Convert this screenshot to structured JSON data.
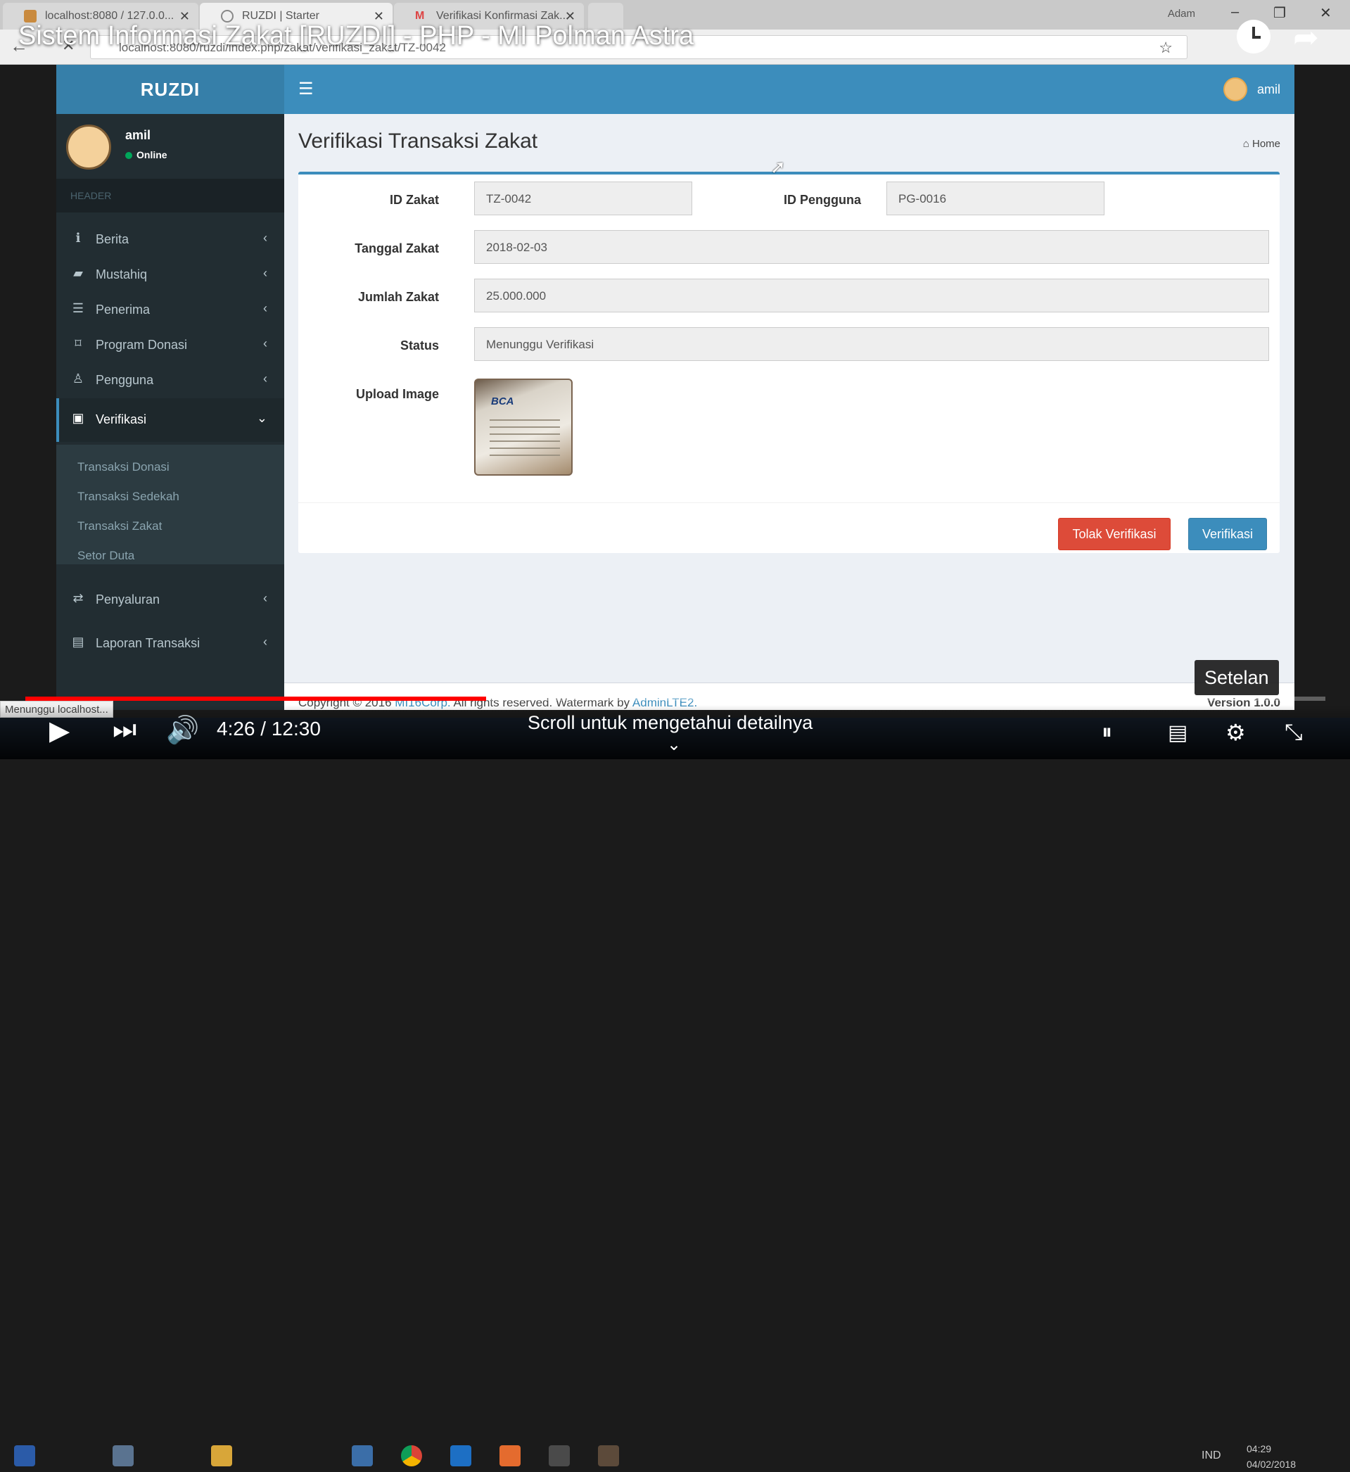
{
  "browser": {
    "tabs": [
      {
        "label": "localhost:8080 / 127.0.0...",
        "active": false
      },
      {
        "label": "RUZDI | Starter",
        "active": true
      },
      {
        "label": "Verifikasi Konfirmasi Zak...",
        "active": false
      }
    ],
    "window_user": "Adam",
    "url": "localhost:8080/ruzdi/index.php/zakat/verifikasi_zakat/TZ-0042",
    "status": "Menunggu localhost..."
  },
  "app": {
    "logo": "RUZDI",
    "top_user": "amil",
    "sidebar": {
      "user_name": "amil",
      "user_status": "Online",
      "header": "HEADER",
      "items": [
        {
          "label": "Berita",
          "icon": "info-icon"
        },
        {
          "label": "Mustahiq",
          "icon": "book-icon"
        },
        {
          "label": "Penerima",
          "icon": "list-icon"
        },
        {
          "label": "Program Donasi",
          "icon": "bookmark-icon"
        },
        {
          "label": "Pengguna",
          "icon": "user-icon"
        },
        {
          "label": "Verifikasi",
          "icon": "calendar-check-icon",
          "active": true
        },
        {
          "label": "Penyaluran",
          "icon": "exchange-icon"
        },
        {
          "label": "Laporan Transaksi",
          "icon": "report-icon"
        }
      ],
      "submenu": [
        "Transaksi Donasi",
        "Transaksi Sedekah",
        "Transaksi Zakat",
        "Setor Duta"
      ]
    },
    "page": {
      "title": "Verifikasi Transaksi Zakat",
      "breadcrumb": "Home",
      "form": {
        "id_zakat_label": "ID Zakat",
        "id_zakat": "TZ-0042",
        "id_pengguna_label": "ID Pengguna",
        "id_pengguna": "PG-0016",
        "tanggal_label": "Tanggal Zakat",
        "tanggal": "2018-02-03",
        "jumlah_label": "Jumlah Zakat",
        "jumlah": "25.000.000",
        "status_label": "Status",
        "status": "Menunggu Verifikasi",
        "upload_label": "Upload Image",
        "image_bank_text": "BCA"
      },
      "buttons": {
        "reject": "Tolak Verifikasi",
        "verify": "Verifikasi"
      }
    },
    "footer": {
      "copyright": "Copyright © 2016",
      "company": "MI16Corp.",
      "rights": "All rights reserved. Watermark by",
      "template": "AdminLTE2.",
      "version": "Version 1.0.0"
    }
  },
  "youtube": {
    "title": "Sistem Informasi Zakat [RUZDI] - PHP - MI Polman Astra",
    "time": "4:26 / 12:30",
    "progress": 0.3547,
    "tooltip": "Setelan",
    "scroll_hint": "Scroll untuk mengetahui detailnya"
  },
  "system": {
    "lang": "IND",
    "time": "04:29",
    "date": "04/02/2018"
  },
  "colors": {
    "primary": "#3c8dbc",
    "danger": "#dd4b39",
    "sidebar": "#222d32",
    "progress": "#ff0000"
  }
}
